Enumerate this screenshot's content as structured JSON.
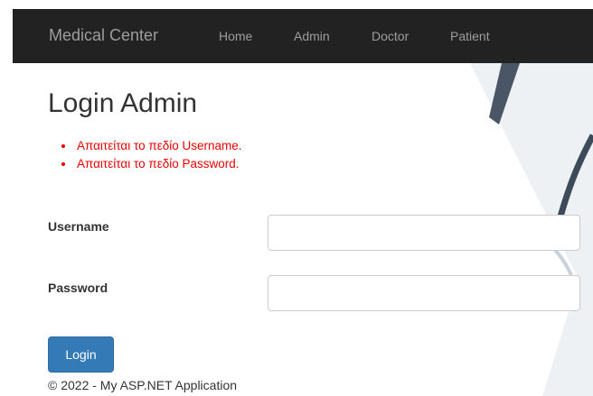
{
  "nav": {
    "brand": "Medical Center",
    "links": [
      "Home",
      "Admin",
      "Doctor",
      "Patient"
    ]
  },
  "page": {
    "title": "Login Admin",
    "errors": [
      "Απαιτείται το πεδίο Username.",
      "Απαιτείται το πεδίο Password."
    ]
  },
  "form": {
    "username_label": "Username",
    "username_value": "",
    "password_label": "Password",
    "password_value": "",
    "login_label": "Login"
  },
  "footer": {
    "text": "© 2022 - My ASP.NET Application"
  },
  "colors": {
    "navbar_bg": "#222222",
    "nav_text": "#9d9d9d",
    "error_text": "#ee0000",
    "button_bg": "#337ab7"
  }
}
